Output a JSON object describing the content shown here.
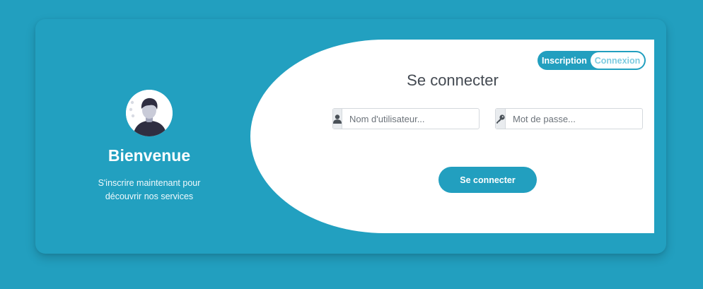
{
  "colors": {
    "background": "#229fbf",
    "accent": "#229fbf",
    "panel": "#ffffff",
    "title_text": "#444a52",
    "toggle_inactive_text": "#7ccbe0"
  },
  "welcome": {
    "avatar_icon": "user-avatar-illustration",
    "title": "Bienvenue",
    "subtitle": "S'inscrire maintenant pour découvrir nos services"
  },
  "toggle": {
    "signup_label": "Inscription",
    "login_label": "Connexion",
    "active": "login"
  },
  "form": {
    "title": "Se connecter",
    "username": {
      "icon": "user-icon",
      "placeholder": "Nom d'utilisateur...",
      "value": ""
    },
    "password": {
      "icon": "key-icon",
      "placeholder": "Mot de passe...",
      "value": ""
    },
    "submit_label": "Se connecter"
  }
}
